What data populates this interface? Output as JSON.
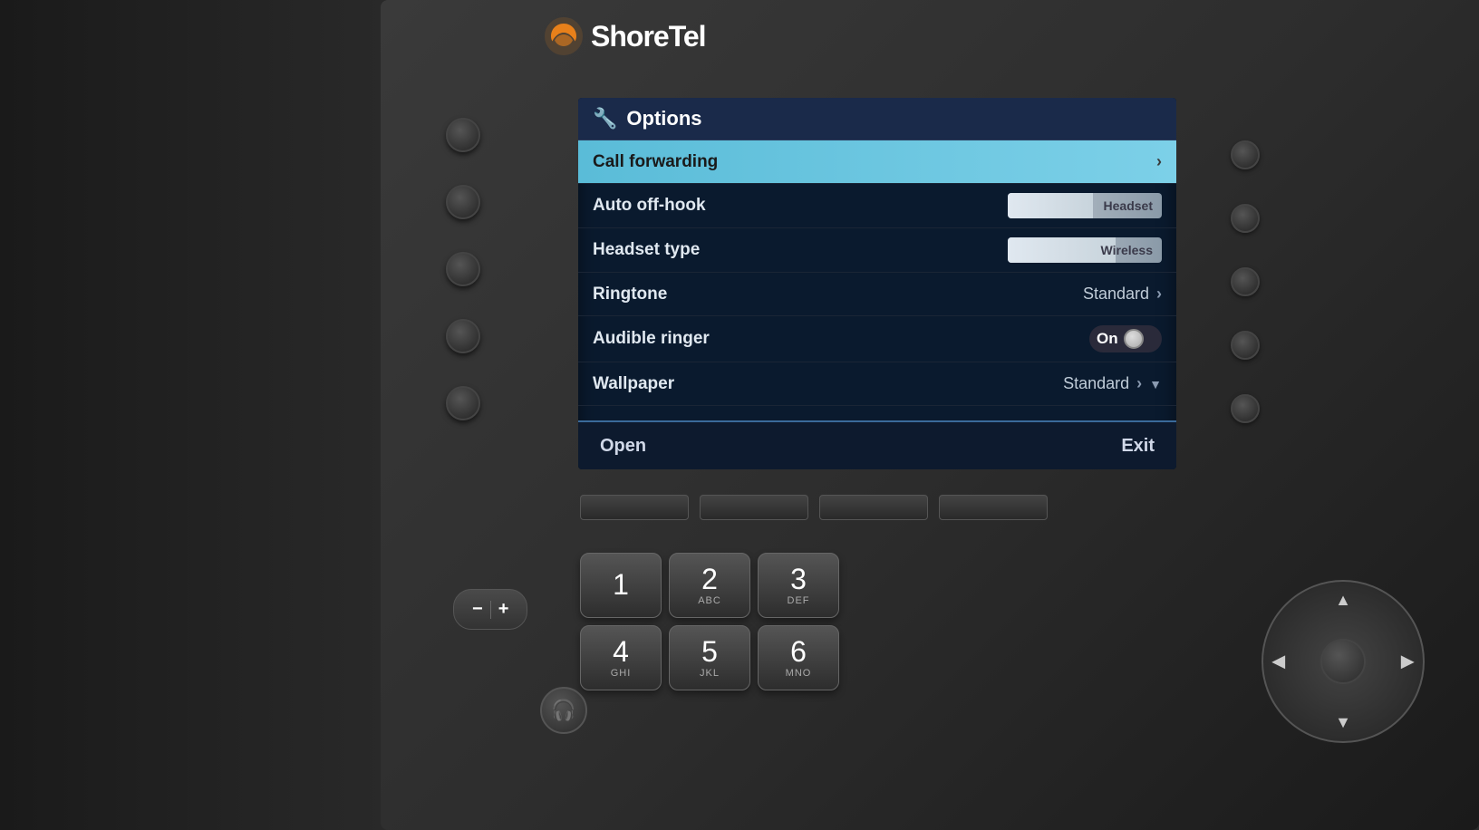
{
  "brand": {
    "name": "ShoreTel",
    "logo_color": "#e8801a"
  },
  "screen": {
    "header": {
      "icon": "wrench",
      "title": "Options"
    },
    "menu_items": [
      {
        "id": "call-forwarding",
        "label": "Call forwarding",
        "value": "",
        "value_type": "chevron",
        "selected": true
      },
      {
        "id": "auto-off-hook",
        "label": "Auto off-hook",
        "value": "Headset",
        "value_type": "slider"
      },
      {
        "id": "headset-type",
        "label": "Headset type",
        "value": "Wireless",
        "value_type": "slider"
      },
      {
        "id": "ringtone",
        "label": "Ringtone",
        "value": "Standard",
        "value_type": "text-chevron"
      },
      {
        "id": "audible-ringer",
        "label": "Audible ringer",
        "value": "On",
        "value_type": "toggle"
      },
      {
        "id": "wallpaper",
        "label": "Wallpaper",
        "value": "Standard",
        "value_type": "text-chevron-down"
      }
    ],
    "bottom_bar": {
      "left_label": "Open",
      "right_label": "Exit"
    }
  },
  "keypad": {
    "rows": [
      [
        {
          "number": "1",
          "letters": ""
        },
        {
          "number": "2",
          "letters": "ABC"
        },
        {
          "number": "3",
          "letters": "DEF"
        }
      ],
      [
        {
          "number": "4",
          "letters": "GHI"
        },
        {
          "number": "5",
          "letters": "JKL"
        },
        {
          "number": "6",
          "letters": "MNO"
        }
      ]
    ]
  },
  "volume": {
    "minus_label": "−",
    "plus_label": "+"
  }
}
